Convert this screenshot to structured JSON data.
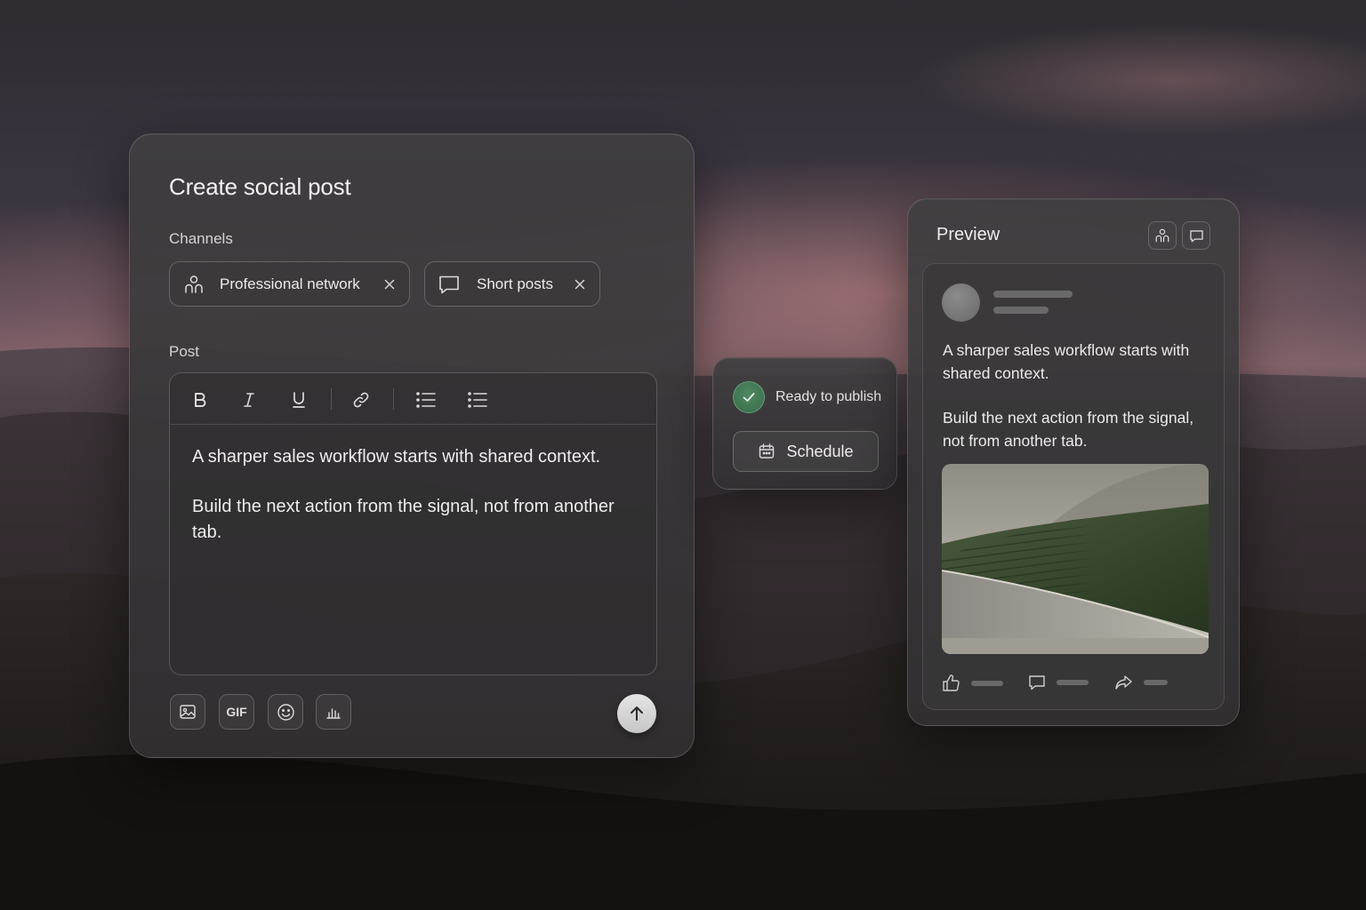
{
  "composer": {
    "title": "Create social post",
    "channels_label": "Channels",
    "channels": [
      {
        "label": "Professional network",
        "icon": "people-icon"
      },
      {
        "label": "Short posts",
        "icon": "speech-bubble-icon"
      }
    ],
    "post_label": "Post",
    "toolbar": [
      "bold",
      "italic",
      "underline",
      "link",
      "bulleted-list",
      "numbered-list"
    ],
    "body": [
      "A sharper sales workflow starts with shared context.",
      "Build the next action from the signal, not from another tab."
    ],
    "attachments": {
      "image_icon": "image-icon",
      "gif_label": "GIF",
      "emoji_icon": "emoji-icon",
      "poll_icon": "poll-icon"
    },
    "send_icon": "arrow-up-icon"
  },
  "publish": {
    "status": "Ready to publish",
    "schedule_label": "Schedule",
    "status_color": "#4a8a5e"
  },
  "preview": {
    "title": "Preview",
    "body": [
      "A sharper sales workflow starts with shared context.",
      "Build the next action from the signal, not from another tab."
    ],
    "actions": [
      "like-icon",
      "comment-icon",
      "share-icon"
    ]
  }
}
